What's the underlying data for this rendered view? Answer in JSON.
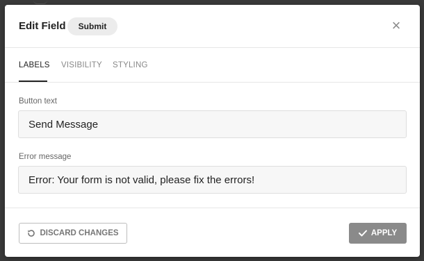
{
  "dialog": {
    "title": "Edit Field",
    "field_type_pill": "Submit",
    "close_glyph": "×"
  },
  "tabs": [
    {
      "label": "LABELS",
      "active": true
    },
    {
      "label": "VISIBILITY",
      "active": false
    },
    {
      "label": "STYLING",
      "active": false
    }
  ],
  "fields": {
    "button_text": {
      "label": "Button text",
      "value": "Send Message"
    },
    "error_message": {
      "label": "Error message",
      "value": "Error: Your form is not valid, please fix the errors!"
    }
  },
  "footer": {
    "discard_label": "DISCARD CHANGES",
    "apply_label": "APPLY"
  },
  "icons": {
    "close": "close-icon",
    "discard": "undo-icon",
    "apply": "check-icon"
  },
  "colors": {
    "apply_bg": "#8a8a8a",
    "active_tab": "#222222",
    "inactive_tab": "#888888"
  }
}
